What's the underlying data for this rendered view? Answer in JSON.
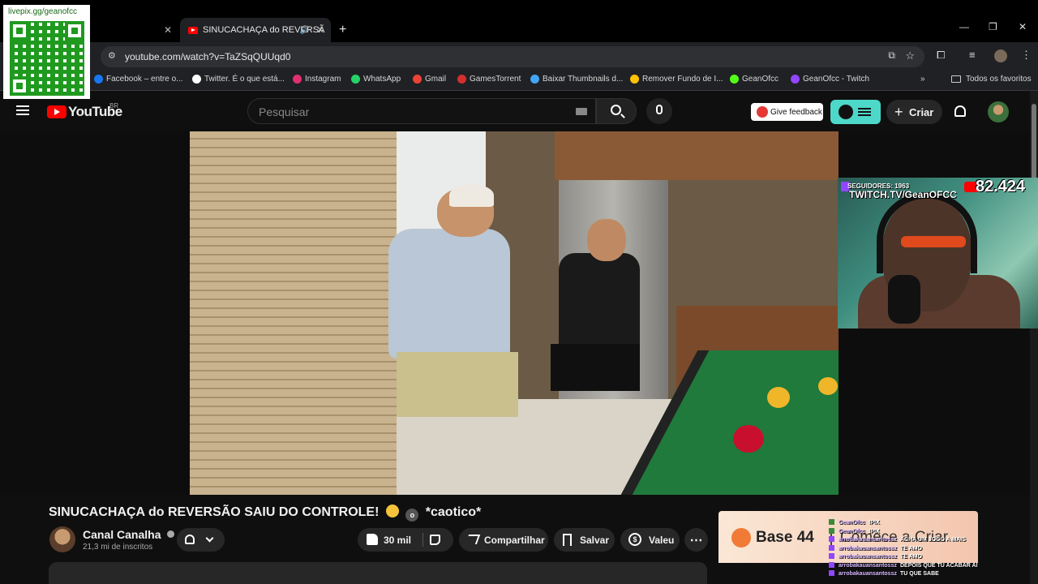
{
  "browser": {
    "active_tab_title": "SINUCACHAÇA do REVERSÃ",
    "url": "youtube.com/watch?v=TaZSqQUUqd0",
    "bookmarks": [
      {
        "label": "Facebook – entre o...",
        "icon": "facebook-icon",
        "color": "#1877f2"
      },
      {
        "label": "Twitter. É o que está...",
        "icon": "x-icon",
        "color": "#ffffff"
      },
      {
        "label": "Instagram",
        "icon": "instagram-icon",
        "color": "#e1306c"
      },
      {
        "label": "WhatsApp",
        "icon": "whatsapp-icon",
        "color": "#25d366"
      },
      {
        "label": "Gmail",
        "icon": "gmail-icon",
        "color": "#ea4335"
      },
      {
        "label": "GamesTorrent",
        "icon": "gamestorrent-icon",
        "color": "#d32f2f"
      },
      {
        "label": "Baixar Thumbnails d...",
        "icon": "thumbnail-icon",
        "color": "#42a5f5"
      },
      {
        "label": "Remover Fundo de I...",
        "icon": "removebg-icon",
        "color": "#ffc107"
      },
      {
        "label": "GeanOfcc",
        "icon": "kick-icon",
        "color": "#53fc18"
      },
      {
        "label": "GeanOfcc - Twitch",
        "icon": "twitch-icon",
        "color": "#9146ff"
      }
    ],
    "all_bookmarks_label": "Todos os favoritos"
  },
  "qr": {
    "label": "livepix.gg/geanofcc"
  },
  "youtube": {
    "logo_text": "YouTube",
    "region": "BR",
    "search_placeholder": "Pesquisar",
    "feedback_label": "Give feedback",
    "create_label": "Criar"
  },
  "webcam": {
    "followers_text": "SEGUIDORES: 1963",
    "channel_text": "TWITCH.TV/GeanOFCC",
    "viewer_count": "82.424"
  },
  "video": {
    "title": "SINUCACHAÇA do REVERSÃO SAIU DO CONTROLE!",
    "title_tag": "*caotico*",
    "channel_name": "Canal Canalha",
    "subscribers": "21,3 mi de inscritos",
    "likes": "30 mil",
    "share_label": "Compartilhar",
    "save_label": "Salvar",
    "valeu_label": "Valeu"
  },
  "ad": {
    "brand": "Base 44",
    "cta": "Comece a Criar"
  },
  "chat": [
    {
      "user": "GeanOfcc",
      "text": "!PIX"
    },
    {
      "user": "GeanOfcc",
      "text": "!PIX"
    },
    {
      "user": "arrobakauansantossz",
      "text": "ACHA UM JOGO A MAIS"
    },
    {
      "user": "arrobakauansantossz",
      "text": "TE AMO"
    },
    {
      "user": "arrobakauansantossz",
      "text": "TE AMO"
    },
    {
      "user": "arrobakauansantossz",
      "text": "DEPOIS QUE TU ACABAR AI"
    },
    {
      "user": "arrobakauansantossz",
      "text": "TU QUE SABE"
    }
  ]
}
